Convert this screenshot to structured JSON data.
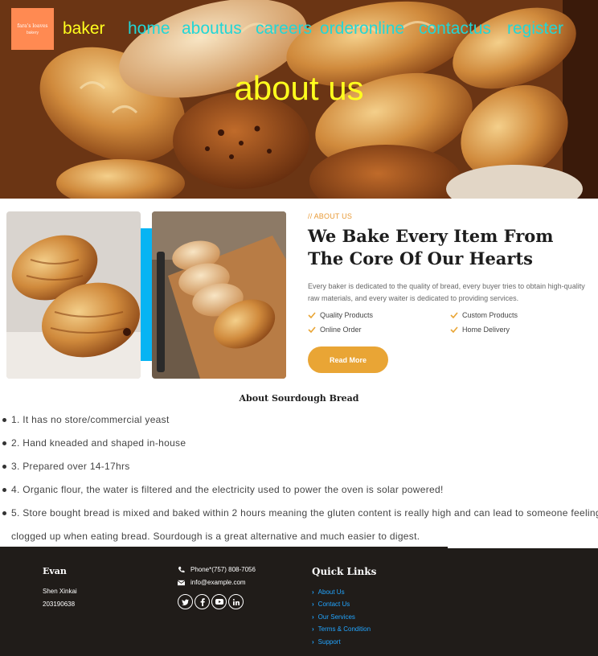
{
  "header": {
    "logo_text": "fara's loaves",
    "logo_sub": "bakery",
    "nav": [
      {
        "label": "baker",
        "kind": "brand"
      },
      {
        "label": "home",
        "kind": "link"
      },
      {
        "label": "aboutus",
        "kind": "link"
      },
      {
        "label": "careers",
        "kind": "link"
      },
      {
        "label": "orderonline",
        "kind": "link"
      },
      {
        "label": "contactus",
        "kind": "link"
      },
      {
        "label": "register",
        "kind": "link"
      }
    ],
    "title": "about us"
  },
  "about": {
    "eyebrow": "// ABOUT US",
    "heading": "We Bake Every Item From The Core Of Our Hearts",
    "description": "Every baker is dedicated to the quality of bread, every buyer tries to obtain high-quality raw materials, and every waiter is dedicated to providing services.",
    "features": [
      "Quality Products",
      "Custom Products",
      "Online Order",
      "Home Delivery"
    ],
    "button": "Read More"
  },
  "sourdough": {
    "heading": "About Sourdough Bread",
    "items": [
      "1. It has no store/commercial yeast",
      "2. Hand kneaded and shaped in-house",
      "3. Prepared over 14-17hrs",
      "4. Organic flour, the water is filtered and the electricity used to power the oven is solar powered!",
      "5. Store bought bread is mixed and baked within 2 hours meaning the gluten content is really high and can lead to someone feeling clogged up when eating bread. Sourdough is a great alternative and much easier to digest."
    ]
  },
  "footer": {
    "name": "Evan",
    "line1": "Shen Xinkai",
    "line2": "203190638",
    "phone": "Phone*(757) 808-7056",
    "email": "info@example.com",
    "social": [
      "twitter-icon",
      "facebook-icon",
      "youtube-icon",
      "linkedin-icon"
    ],
    "quick_links_title": "Quick Links",
    "quick_links": [
      "About Us",
      "Contact Us",
      "Our Services",
      "Terms & Condition",
      "Support"
    ]
  },
  "colors": {
    "nav_brand": "#ffff1e",
    "nav_link": "#22d6d6",
    "accent": "#e9a535",
    "footer_bg": "#201c19",
    "link_blue": "#22a5ff"
  }
}
